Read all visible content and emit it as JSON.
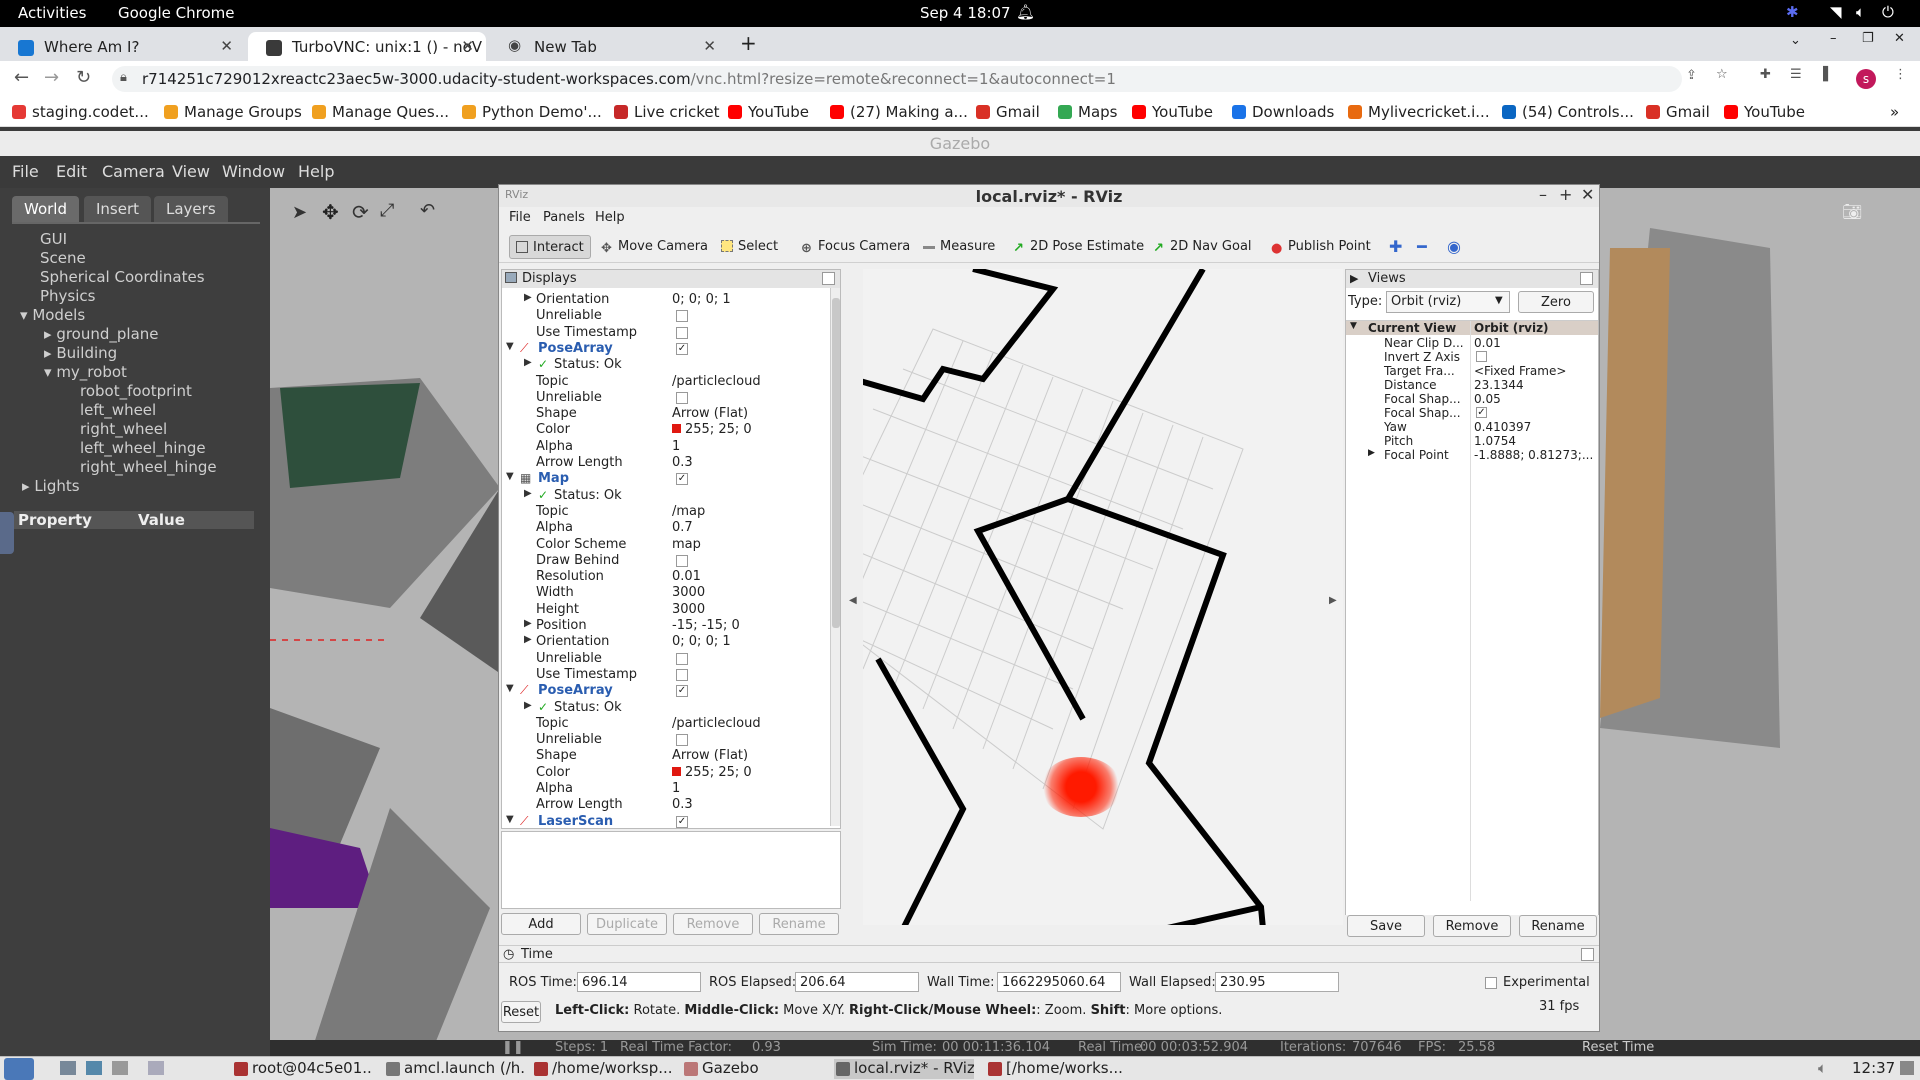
{
  "gnome": {
    "activities": "Activities",
    "app": "Google Chrome",
    "clock": "Sep 4  18:07"
  },
  "chrome": {
    "tabs": [
      {
        "title": "Where Am I?"
      },
      {
        "title": "TurboVNC: unix:1 () - noV"
      },
      {
        "title": "New Tab"
      }
    ],
    "url_host": "r714251c729012xreactc23aec5w-3000.udacity-student-workspaces.com",
    "url_path": "/vnc.html?resize=remote&reconnect=1&autoconnect=1",
    "avatar": "s",
    "bookmarks": [
      "staging.codet...",
      "Manage Groups",
      "Manage Ques...",
      "Python Demo'...",
      "Live cricket",
      "YouTube",
      "(27) Making a...",
      "Gmail",
      "Maps",
      "YouTube",
      "Downloads",
      "Mylivecricket.i...",
      "(54) Controls...",
      "Gmail",
      "YouTube"
    ]
  },
  "gazebo": {
    "title": "Gazebo",
    "menu": [
      "File",
      "Edit",
      "Camera",
      "View",
      "Window",
      "Help"
    ],
    "tabs": [
      "World",
      "Insert",
      "Layers"
    ],
    "tree": [
      "GUI",
      "Scene",
      "Spherical Coordinates",
      "Physics",
      "Models",
      "ground_plane",
      "Building",
      "my_robot",
      "robot_footprint",
      "left_wheel",
      "right_wheel",
      "left_wheel_hinge",
      "right_wheel_hinge",
      "Lights"
    ],
    "prop_header": "Property",
    "value_header": "Value",
    "bottom": {
      "steps": "Steps: 1",
      "rtf_label": "Real Time Factor:",
      "rtf": "0.93",
      "sim_label": "Sim Time:",
      "sim": "00 00:11:36.104",
      "real_label": "Real Time:",
      "real": "00 00:03:52.904",
      "iter_label": "Iterations:",
      "iter": "707646",
      "fps_label": "FPS:",
      "fps": "25.58",
      "reset": "Reset Time"
    }
  },
  "rviz": {
    "title": "local.rviz* - RViz",
    "menu": [
      "File",
      "Panels",
      "Help"
    ],
    "tools": [
      "Interact",
      "Move Camera",
      "Select",
      "Focus Camera",
      "Measure",
      "2D Pose Estimate",
      "2D Nav Goal",
      "Publish Point"
    ],
    "displays_title": "Displays",
    "rows": [
      {
        "k": "Orientation",
        "v": "0; 0; 0; 1",
        "indent": 1
      },
      {
        "k": "Unreliable",
        "chk": "",
        "indent": 2
      },
      {
        "k": "Use Timestamp",
        "chk": "",
        "indent": 2
      },
      {
        "k": "PoseArray",
        "chk": "✓",
        "indent": 0,
        "head": "pose"
      },
      {
        "k": "Status: Ok",
        "indent": 1,
        "status": true
      },
      {
        "k": "Topic",
        "v": "/particlecloud",
        "indent": 2
      },
      {
        "k": "Unreliable",
        "chk": "",
        "indent": 2
      },
      {
        "k": "Shape",
        "v": "Arrow (Flat)",
        "indent": 2
      },
      {
        "k": "Color",
        "v": "255; 25; 0",
        "indent": 2,
        "swatch": "#e01810"
      },
      {
        "k": "Alpha",
        "v": "1",
        "indent": 2
      },
      {
        "k": "Arrow Length",
        "v": "0.3",
        "indent": 2
      },
      {
        "k": "Map",
        "chk": "✓",
        "indent": 0,
        "head": "map"
      },
      {
        "k": "Status: Ok",
        "indent": 1,
        "status": true
      },
      {
        "k": "Topic",
        "v": "/map",
        "indent": 2
      },
      {
        "k": "Alpha",
        "v": "0.7",
        "indent": 2
      },
      {
        "k": "Color Scheme",
        "v": "map",
        "indent": 2
      },
      {
        "k": "Draw Behind",
        "chk": "",
        "indent": 2
      },
      {
        "k": "Resolution",
        "v": "0.01",
        "indent": 2
      },
      {
        "k": "Width",
        "v": "3000",
        "indent": 2
      },
      {
        "k": "Height",
        "v": "3000",
        "indent": 2
      },
      {
        "k": "Position",
        "v": "-15; -15; 0",
        "indent": 1
      },
      {
        "k": "Orientation",
        "v": "0; 0; 0; 1",
        "indent": 1
      },
      {
        "k": "Unreliable",
        "chk": "",
        "indent": 2
      },
      {
        "k": "Use Timestamp",
        "chk": "",
        "indent": 2
      },
      {
        "k": "PoseArray",
        "chk": "✓",
        "indent": 0,
        "head": "pose"
      },
      {
        "k": "Status: Ok",
        "indent": 1,
        "status": true
      },
      {
        "k": "Topic",
        "v": "/particlecloud",
        "indent": 2
      },
      {
        "k": "Unreliable",
        "chk": "",
        "indent": 2
      },
      {
        "k": "Shape",
        "v": "Arrow (Flat)",
        "indent": 2
      },
      {
        "k": "Color",
        "v": "255; 25; 0",
        "indent": 2,
        "swatch": "#e01810"
      },
      {
        "k": "Alpha",
        "v": "1",
        "indent": 2
      },
      {
        "k": "Arrow Length",
        "v": "0.3",
        "indent": 2
      },
      {
        "k": "LaserScan",
        "chk": "✓",
        "indent": 0,
        "head": "laser"
      }
    ],
    "buttons": [
      "Add",
      "Duplicate",
      "Remove",
      "Rename"
    ],
    "views": {
      "title": "Views",
      "type_label": "Type:",
      "type_value": "Orbit (rviz)",
      "zero": "Zero",
      "current_view": "Current View",
      "current_value": "Orbit (rviz)",
      "props": [
        {
          "k": "Near Clip D...",
          "v": "0.01"
        },
        {
          "k": "Invert Z Axis",
          "chk": ""
        },
        {
          "k": "Target Fra...",
          "v": "<Fixed Frame>"
        },
        {
          "k": "Distance",
          "v": "23.1344"
        },
        {
          "k": "Focal Shap...",
          "v": "0.05"
        },
        {
          "k": "Focal Shap...",
          "chk": "✓"
        },
        {
          "k": "Yaw",
          "v": "0.410397"
        },
        {
          "k": "Pitch",
          "v": "1.0754"
        },
        {
          "k": "Focal Point",
          "v": "-1.8888; 0.81273;..."
        }
      ],
      "buttons": [
        "Save",
        "Remove",
        "Rename"
      ]
    },
    "time": {
      "title": "Time",
      "ros_time_label": "ROS Time:",
      "ros_time": "696.14",
      "ros_elapsed_label": "ROS Elapsed:",
      "ros_elapsed": "206.64",
      "wall_time_label": "Wall Time:",
      "wall_time": "1662295060.64",
      "wall_elapsed_label": "Wall Elapsed:",
      "wall_elapsed": "230.95",
      "experimental": "Experimental",
      "reset": "Reset",
      "help_b1": "Left-Click:",
      "help_t1": " Rotate. ",
      "help_b2": "Middle-Click:",
      "help_t2": " Move X/Y. ",
      "help_b3": "Right-Click/Mouse Wheel:",
      "help_t3": ": Zoom. ",
      "help_b4": "Shift",
      "help_t4": ": More options.",
      "fps": "31 fps"
    }
  },
  "taskbar": {
    "items": [
      "root@04c5e01...",
      "amcl.launch (/h...",
      "/home/worksp...",
      "Gazebo",
      "local.rviz* - RViz",
      "[/home/works..."
    ],
    "clock": "12:37"
  }
}
